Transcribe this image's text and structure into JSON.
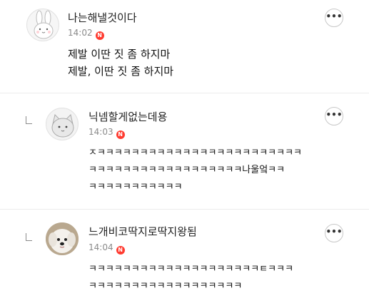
{
  "comments": [
    {
      "nickname": "나는해낼것이다",
      "time": "14:02",
      "new_badge": "N",
      "more_label": "•••",
      "lines": [
        "제발 이딴 짓 좀 하지마",
        "제발, 이딴 짓 좀 하지마"
      ],
      "is_reply": false,
      "avatar_icon": "rabbit-avatar-icon"
    },
    {
      "nickname": "닉넴할게없는데용",
      "time": "14:03",
      "new_badge": "N",
      "more_label": "•••",
      "lines": [
        "ㅈㅋㅋㅋㅋㅋㅋㅋㅋㅋㅋㅋㅋㅋㅋㅋㅋㅋㅋㅋㅋㅋㅋㅋㅋ",
        "ㅋㅋㅋㅋㅋㅋㅋㅋㅋㅋㅋㅋㅋㅋㅋㅋㅋㅋ나울엌ㅋㅋ",
        "ㅋㅋㅋㅋㅋㅋㅋㅋㅋㅋㅋ"
      ],
      "is_reply": true,
      "avatar_icon": "cat-avatar-icon"
    },
    {
      "nickname": "느개비코딱지로딱지왕됨",
      "time": "14:04",
      "new_badge": "N",
      "more_label": "•••",
      "lines": [
        "ㅋㅋㅋㅋㅋㅋㅋㅋㅋㅋㅋㅋㅋㅋㅋㅋㅋㅋㅋㅋㅌㅋㅋㅋ",
        "ㅋㅋㅋㅋㅋㅋㅋㅋㅋㅋㅋㅋㅋㅋㅋㅋㅋㅋ"
      ],
      "is_reply": true,
      "avatar_icon": "dog-photo-avatar"
    }
  ],
  "colors": {
    "badge": "#ff3b30",
    "divider": "#ececec",
    "time": "#8a8a8a"
  }
}
